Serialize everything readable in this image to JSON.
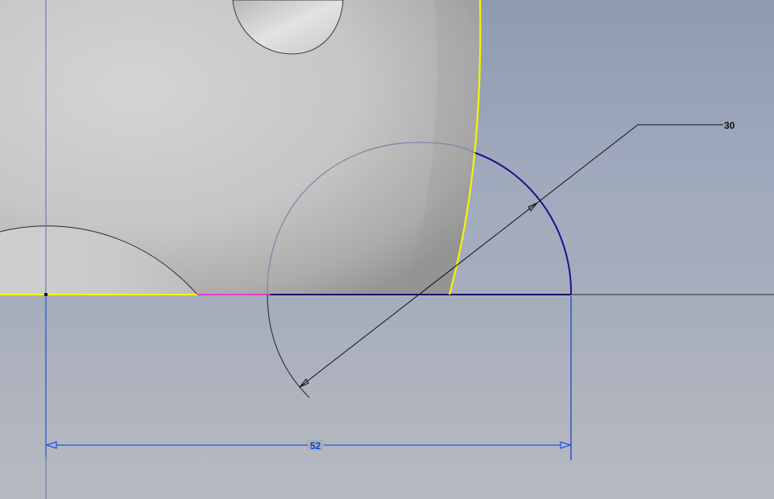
{
  "viewport": {
    "background_top": "#8f9ab1",
    "background_bottom": "#b7bac1"
  },
  "colors": {
    "sketch_line": "#1b0b6e",
    "selected_edge": "#f5f500",
    "constraint_highlight": "#e040d0",
    "dimension_driving": "#0a3fd8",
    "dimension_leader": "#111111",
    "construction_arc": "#8a82a8",
    "axis_line": "#4a4a4a",
    "part_face": "#d0d0d0"
  },
  "dimensions": {
    "diameter": {
      "value": "30",
      "kind": "diameter-dimension"
    },
    "horizontal": {
      "value": "52",
      "kind": "linear-dimension"
    }
  }
}
